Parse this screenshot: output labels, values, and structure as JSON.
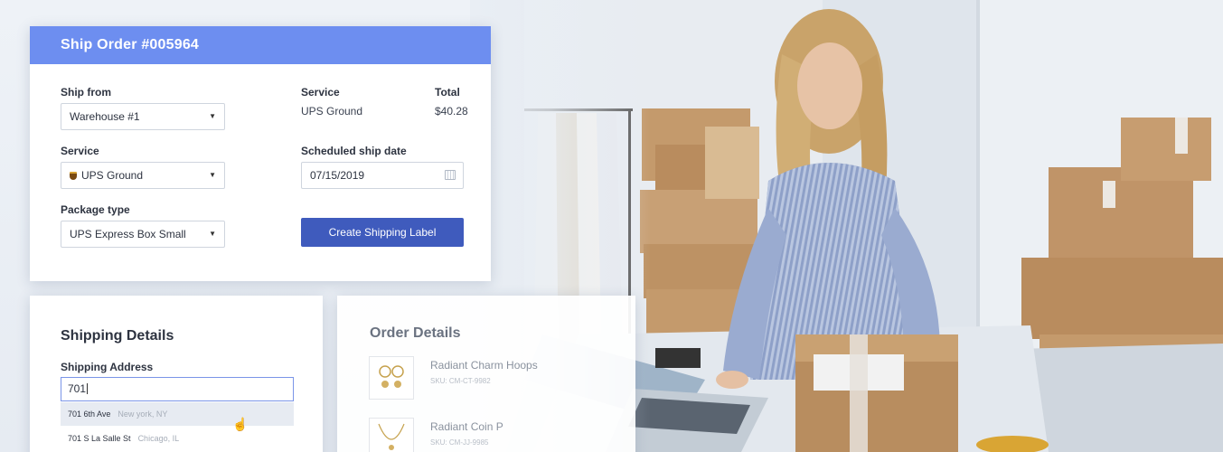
{
  "ship_order": {
    "title": "Ship Order #005964",
    "ship_from_label": "Ship from",
    "ship_from_value": "Warehouse #1",
    "service_label": "Service",
    "service_value": "UPS Ground",
    "package_type_label": "Package type",
    "package_type_value": "UPS Express Box Small",
    "summary_service_label": "Service",
    "summary_service_value": "UPS Ground",
    "summary_total_label": "Total",
    "summary_total_value": "$40.28",
    "scheduled_date_label": "Scheduled ship date",
    "scheduled_date_value": "07/15/2019",
    "create_label_button": "Create Shipping Label"
  },
  "shipping_details": {
    "title": "Shipping Details",
    "address_label": "Shipping Address",
    "address_value": "701",
    "suggestions": [
      {
        "street": "701 6th Ave",
        "city": "New york, NY"
      },
      {
        "street": "701 S La Salle St",
        "city": "Chicago, IL"
      }
    ]
  },
  "order_details": {
    "title": "Order Details",
    "items": [
      {
        "name": "Radiant Charm Hoops",
        "sku": "SKU: CM-CT-9982"
      },
      {
        "name": "Radiant Coin P",
        "sku": "SKU: CM-JJ-9985"
      }
    ]
  },
  "icons": {
    "select_caret": "▼",
    "calendar": "calendar-icon",
    "ups": "ups-logo-icon",
    "pointer": "hand-pointer-icon"
  },
  "colors": {
    "header_blue": "#6d8ef0",
    "button_blue": "#3f5bbd",
    "input_focus": "#7a95e8"
  }
}
